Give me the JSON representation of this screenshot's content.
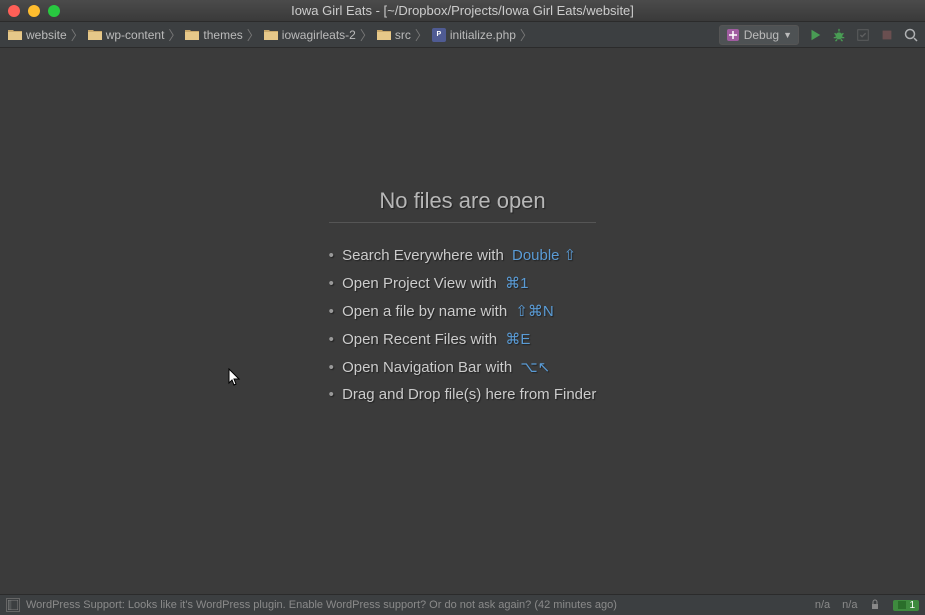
{
  "window": {
    "title": "Iowa Girl Eats - [~/Dropbox/Projects/Iowa Girl Eats/website]"
  },
  "breadcrumbs": [
    {
      "label": "website",
      "icon": "folder"
    },
    {
      "label": "wp-content",
      "icon": "folder"
    },
    {
      "label": "themes",
      "icon": "folder"
    },
    {
      "label": "iowagirleats-2",
      "icon": "folder"
    },
    {
      "label": "src",
      "icon": "folder"
    },
    {
      "label": "initialize.php",
      "icon": "php"
    }
  ],
  "runConfig": {
    "selected": "Debug"
  },
  "emptyState": {
    "title": "No files are open",
    "tips": [
      {
        "text": "Search Everywhere with",
        "shortcut": "Double ⇧"
      },
      {
        "text": "Open Project View with",
        "shortcut": "⌘1"
      },
      {
        "text": "Open a file by name with",
        "shortcut": "⇧⌘N"
      },
      {
        "text": "Open Recent Files with",
        "shortcut": "⌘E"
      },
      {
        "text": "Open Navigation Bar with",
        "shortcut": "⌥↖"
      },
      {
        "text": "Drag and Drop file(s) here from Finder",
        "shortcut": ""
      }
    ]
  },
  "status": {
    "message": "WordPress Support: Looks like it's WordPress plugin. Enable WordPress support? Or do not ask again? (42 minutes ago)",
    "right1": "n/a",
    "right2": "n/a",
    "badge": "1"
  }
}
